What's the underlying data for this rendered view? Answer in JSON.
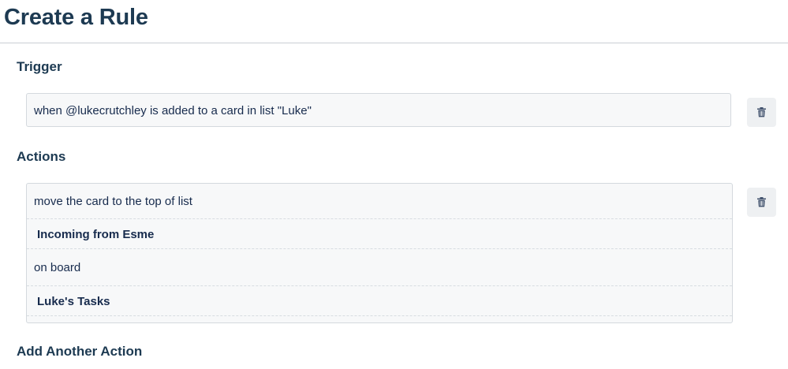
{
  "page": {
    "title": "Create a Rule"
  },
  "trigger": {
    "heading": "Trigger",
    "text": "when @lukecrutchley is added to a card in list \"Luke\""
  },
  "actions": {
    "heading": "Actions",
    "rows": [
      {
        "kind": "text",
        "text": "move the card to the top of list"
      },
      {
        "kind": "value",
        "text": "Incoming from Esme"
      },
      {
        "kind": "text",
        "text": "on board"
      },
      {
        "kind": "value",
        "text": "Luke's Tasks"
      }
    ]
  },
  "add_action": {
    "heading": "Add Another Action"
  },
  "icons": {
    "delete": "trash-icon"
  },
  "colors": {
    "heading": "#1d3a52",
    "text": "#172b4d",
    "box_bg": "#f7f8f9",
    "button_bg": "#eef0f2"
  }
}
